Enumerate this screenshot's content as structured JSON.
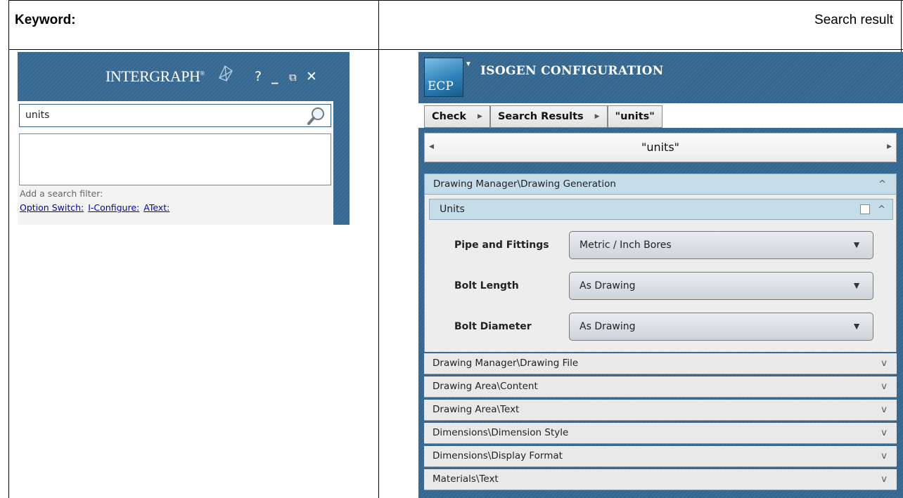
{
  "doc": {
    "keyword_label": "Keyword:",
    "result_label": "Search result"
  },
  "left_window": {
    "brand": "INTERGRAPH",
    "brand_mark": "®",
    "help": "?",
    "minimize": "_",
    "restore": "⧉",
    "close": "✕",
    "search": {
      "value": "units"
    },
    "filter_label": "Add a search filter:",
    "filters": [
      "Option Switch:",
      "I-Configure:",
      "AText:"
    ]
  },
  "right_app": {
    "logo": "ECP",
    "title": "ISOGEN CONFIGURATION",
    "breadcrumb": [
      "Check",
      "Search Results",
      "\"units\""
    ],
    "pager_title": "\"units\"",
    "open_section": {
      "title": "Drawing Manager\\Drawing Generation",
      "subsection": "Units",
      "settings": [
        {
          "label": "Pipe and Fittings",
          "value": "Metric / Inch Bores"
        },
        {
          "label": "Bolt Length",
          "value": "As Drawing"
        },
        {
          "label": "Bolt Diameter",
          "value": "As Drawing"
        }
      ]
    },
    "collapsed_sections": [
      "Drawing Manager\\Drawing File",
      "Drawing Area\\Content",
      "Drawing Area\\Text",
      "Dimensions\\Dimension Style",
      "Dimensions\\Display Format",
      "Materials\\Text"
    ]
  }
}
